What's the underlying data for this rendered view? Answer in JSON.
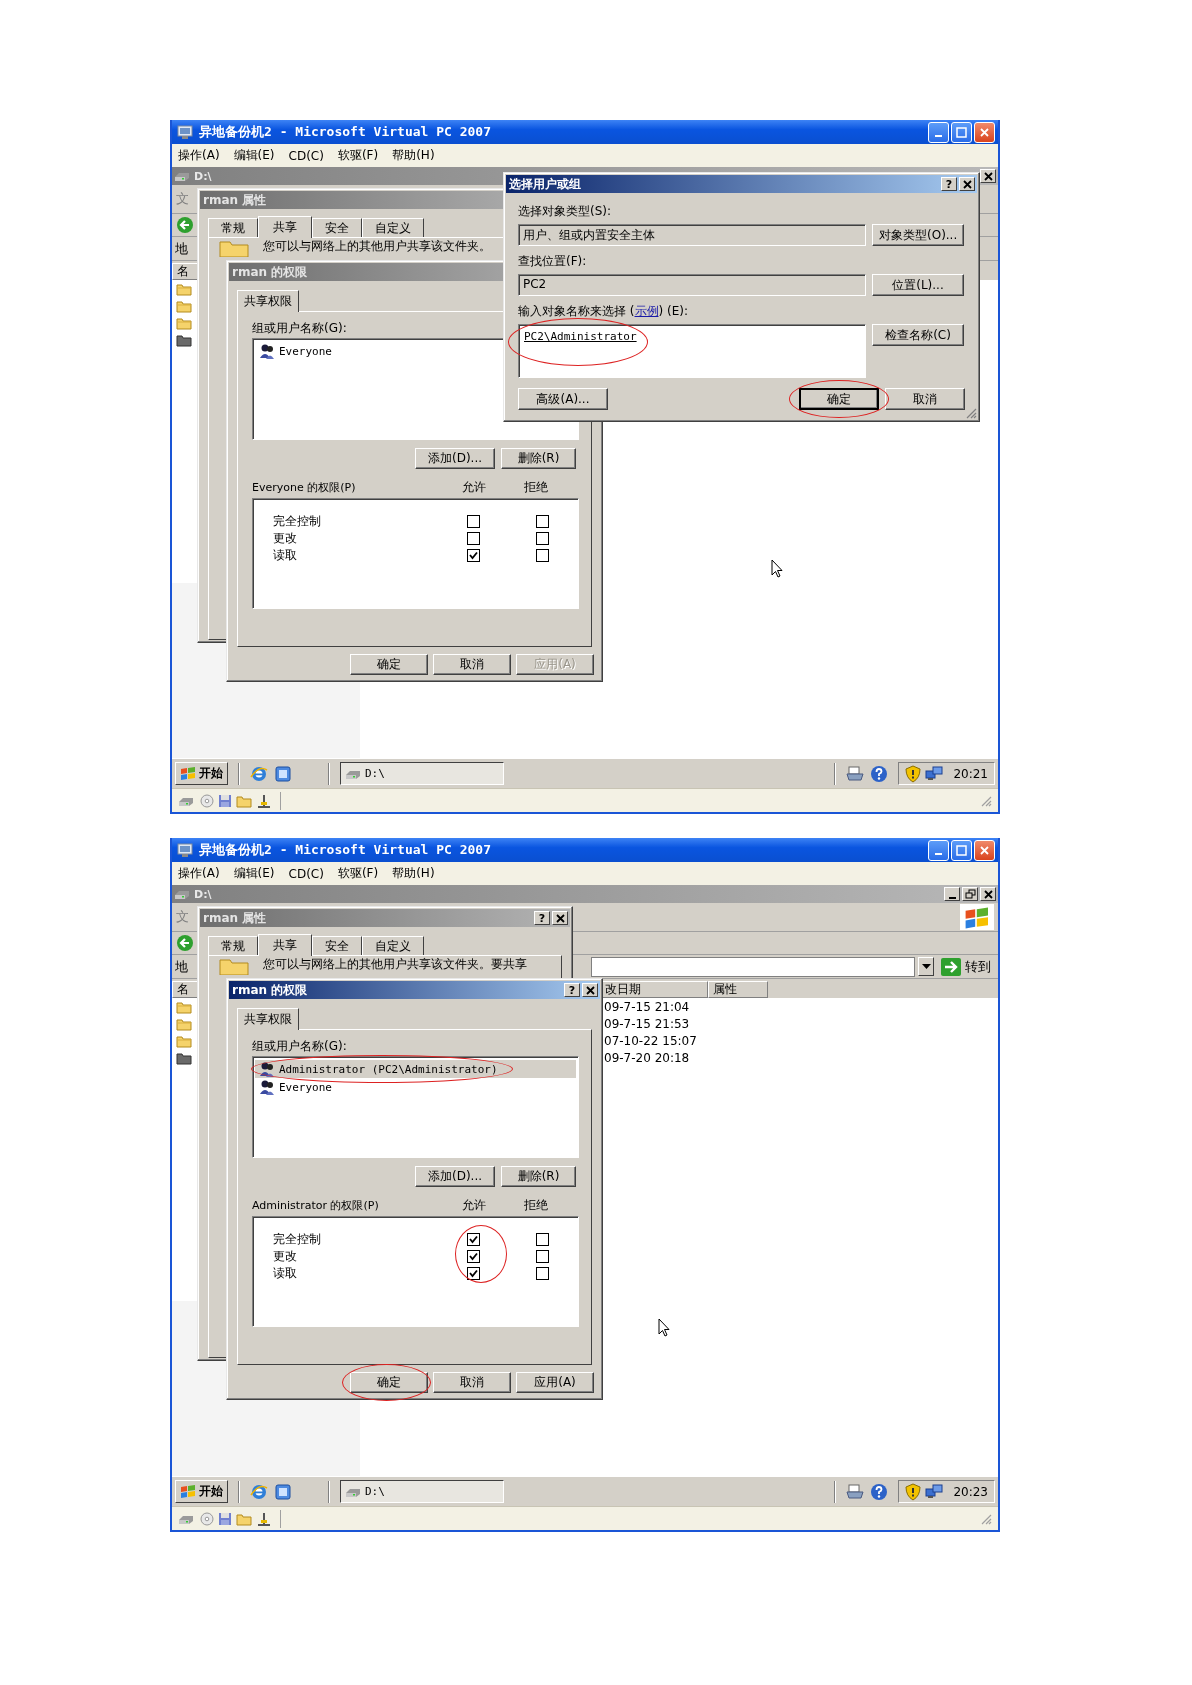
{
  "screenshots": [
    {
      "window": {
        "title": "异地备份机2 - Microsoft Virtual PC 2007"
      },
      "menu": [
        "操作(A)",
        "编辑(E)",
        "CD(C)",
        "软驱(F)",
        "帮助(H)"
      ],
      "explorer": {
        "title": "D:\\",
        "caption_buttons": [
          {
            "kind": "close"
          }
        ],
        "logo": false,
        "menu_fragment": "文",
        "address_label": "地",
        "columns": [
          "名"
        ],
        "rows": [
          {
            "kind": "folder"
          },
          {
            "kind": "folder"
          },
          {
            "kind": "folder"
          },
          {
            "kind": "system-folder"
          }
        ]
      },
      "properties_dialog": {
        "title": "rman 属性",
        "active": false,
        "tabs": [
          {
            "label": "常规",
            "selected": false
          },
          {
            "label": "共享",
            "selected": true
          },
          {
            "label": "安全",
            "selected": false
          },
          {
            "label": "自定义",
            "selected": false
          }
        ],
        "description": "您可以与网络上的其他用户共享该文件夹。"
      },
      "permissions_dialog": {
        "title": "rman 的权限",
        "active": false,
        "tab": "共享权限",
        "users_label": "组或用户名称(G):",
        "users": [
          {
            "name": "Everyone",
            "selected": false,
            "circled": false
          }
        ],
        "add_button": "添加(D)...",
        "remove_button": "删除(R)",
        "permissions_label": "Everyone 的权限(P)",
        "allow_header": "允许",
        "deny_header": "拒绝",
        "allow_circled": false,
        "permissions": [
          {
            "name": "完全控制",
            "allow": false,
            "deny": false
          },
          {
            "name": "更改",
            "allow": false,
            "deny": false
          },
          {
            "name": "读取",
            "allow": true,
            "deny": false
          }
        ],
        "buttons": [
          {
            "label": "确定",
            "disabled": false,
            "circled": false
          },
          {
            "label": "取消",
            "disabled": false,
            "circled": false
          },
          {
            "label": "应用(A)",
            "disabled": true,
            "circled": false
          }
        ]
      },
      "select_dialog": {
        "title": "选择用户或组",
        "active": true,
        "help_button": "?",
        "object_types_label": "选择对象类型(S):",
        "object_types": "用户、组或内置安全主体",
        "object_types_button": "对象类型(O)...",
        "location_label": "查找位置(F):",
        "location": "PC2",
        "location_button": "位置(L)...",
        "names_label_before": "输入对象名称来选择 (",
        "examples_link": "示例",
        "names_label_after": ") (E):",
        "names": "PC2\\Administrator",
        "names_circled": true,
        "check_names_button": "检查名称(C)",
        "advanced_button": "高级(A)...",
        "buttons": [
          {
            "label": "确定",
            "default": true,
            "circled": true
          },
          {
            "label": "取消",
            "default": false,
            "circled": false
          }
        ]
      },
      "taskbar": {
        "start": "开始",
        "tasks": [
          {
            "label": "D:\\"
          }
        ],
        "clock": "20:21"
      }
    },
    {
      "window": {
        "title": "异地备份机2 - Microsoft Virtual PC 2007"
      },
      "menu": [
        "操作(A)",
        "编辑(E)",
        "CD(C)",
        "软驱(F)",
        "帮助(H)"
      ],
      "explorer": {
        "title": "D:\\",
        "caption_buttons": [
          {
            "kind": "minimize"
          },
          {
            "kind": "restore"
          },
          {
            "kind": "close"
          }
        ],
        "logo": true,
        "menu_fragment": "文",
        "address_label": "地",
        "go_button": "转到",
        "columns": [
          "名",
          "改日期",
          "属性"
        ],
        "rows": [
          {
            "kind": "folder",
            "modified": "09-7-15 21:04"
          },
          {
            "kind": "folder",
            "modified": "09-7-15 21:53"
          },
          {
            "kind": "folder",
            "modified": "07-10-22 15:07"
          },
          {
            "kind": "system-folder",
            "modified": "09-7-20 20:18"
          }
        ]
      },
      "properties_dialog": {
        "title": "rman 属性",
        "active": false,
        "help_button": "?",
        "tabs": [
          {
            "label": "常规",
            "selected": false
          },
          {
            "label": "共享",
            "selected": true
          },
          {
            "label": "安全",
            "selected": false
          },
          {
            "label": "自定义",
            "selected": false
          }
        ],
        "description": "您可以与网络上的其他用户共享该文件夹。要共享"
      },
      "permissions_dialog": {
        "title": "rman 的权限",
        "active": true,
        "help_button": "?",
        "tab": "共享权限",
        "users_label": "组或用户名称(G):",
        "users": [
          {
            "name": "Administrator (PC2\\Administrator)",
            "selected": true,
            "circled": true
          },
          {
            "name": "Everyone",
            "selected": false,
            "circled": false
          }
        ],
        "add_button": "添加(D)...",
        "remove_button": "删除(R)",
        "permissions_label": "Administrator 的权限(P)",
        "allow_header": "允许",
        "deny_header": "拒绝",
        "allow_circled": true,
        "permissions": [
          {
            "name": "完全控制",
            "allow": true,
            "deny": false
          },
          {
            "name": "更改",
            "allow": true,
            "deny": false
          },
          {
            "name": "读取",
            "allow": true,
            "deny": false
          }
        ],
        "buttons": [
          {
            "label": "确定",
            "disabled": false,
            "circled": true
          },
          {
            "label": "取消",
            "disabled": false,
            "circled": false
          },
          {
            "label": "应用(A)",
            "disabled": false,
            "circled": false
          }
        ]
      },
      "taskbar": {
        "start": "开始",
        "tasks": [
          {
            "label": "D:\\"
          }
        ],
        "clock": "20:23"
      }
    }
  ]
}
